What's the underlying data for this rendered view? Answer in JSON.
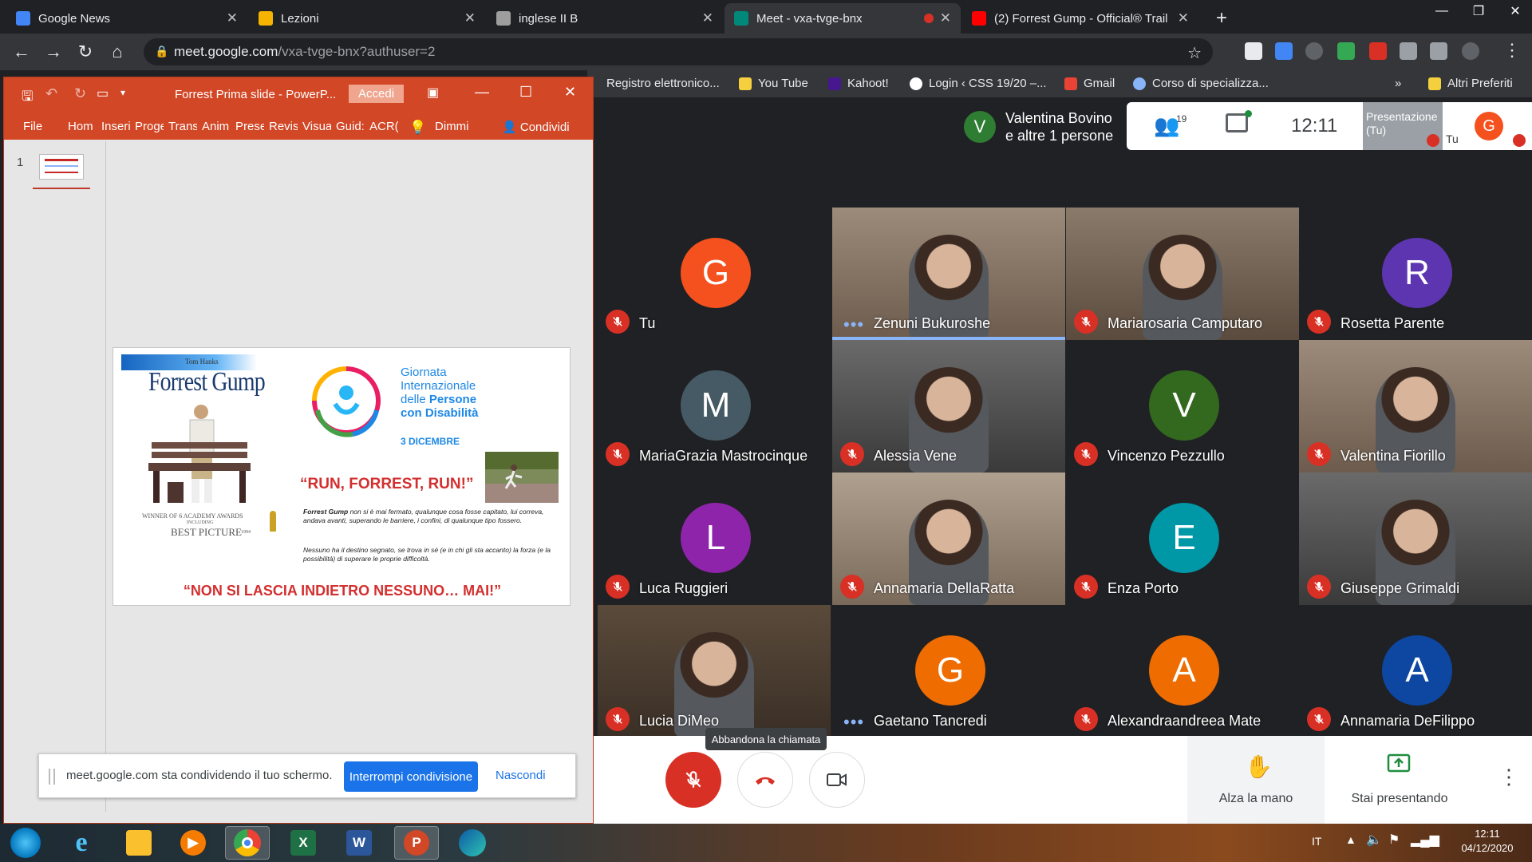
{
  "browser": {
    "tabs": [
      {
        "label": "Google News",
        "icon": "google-news-icon",
        "color": "#4285f4"
      },
      {
        "label": "Lezioni",
        "icon": "classroom-icon",
        "color": "#f4b400"
      },
      {
        "label": "inglese II B",
        "icon": "doc-icon",
        "color": "#9e9e9e"
      },
      {
        "label": "Meet - vxa-tvge-bnx",
        "icon": "meet-icon",
        "color": "#00897b"
      },
      {
        "label": "(2) Forrest Gump - Official® Trail",
        "icon": "youtube-icon",
        "color": "#ff0000"
      }
    ],
    "url_host": "meet.google.com",
    "url_path": "/vxa-tvge-bnx?authuser=2",
    "bookmarks": [
      "Registro elettronico...",
      "You Tube",
      "Kahoot!",
      "Login ‹ CSS 19/20 –...",
      "Gmail",
      "Corso di specializza...",
      "Altri Preferiti"
    ]
  },
  "powerpoint": {
    "title": "Forrest Prima slide  -  PowerP...",
    "signin": "Accedi",
    "ribbon": [
      "File",
      "Hom",
      "Inseri",
      "Proge",
      "Trans",
      "Anim",
      "Prese",
      "Revis",
      "Visua",
      "Guid:",
      "ACR(",
      "Dimmi",
      "Condividi"
    ],
    "slide_number": "1",
    "slide": {
      "tom_hanks": "Tom Hanks",
      "movie_title": "Forrest Gump",
      "awards1": "WINNER OF 6 ACADEMY AWARDS",
      "awards2": "INCLUDING",
      "awards3": "BEST PICTURE",
      "awards4": "1994",
      "event_l1": "Giornata",
      "event_l2": "Internazionale",
      "event_l3a": "delle ",
      "event_l3b": "Persone",
      "event_l4": "con Disabilità",
      "event_date": "3 DICEMBRE",
      "run": "“RUN, FORREST, RUN!”",
      "text_name": "Forrest Gump",
      "text1": " non si è mai fermato, qualunque cosa fosse capitato, lui correva, andava avanti, superando le barriere, i confini, di qualunque tipo fossero.",
      "text2": "Nessuno ha il destino segnato, se trova in sé (e in chi gli sta accanto) la forza (e la possibilità) di superare le proprie difficoltà.",
      "footer": "“NON SI LASCIA INDIETRO NESSUNO… MAI!”"
    }
  },
  "sharebar": {
    "message": "meet.google.com sta condividendo il tuo schermo.",
    "stop": "Interrompi condivisione",
    "hide": "Nascondi"
  },
  "meet": {
    "presenter": {
      "initial": "V",
      "line1": "Valentina Bovino",
      "line2": "e altre 1 persone"
    },
    "people_count": "19",
    "time": "12:11",
    "presentation_label1": "Presentazione",
    "presentation_label2": "(Tu)",
    "self_label": "Tu",
    "self_initial": "G",
    "tooltip": "Abbandona la chiamata",
    "raise_hand": "Alza la mano",
    "presenting": "Stai presentando",
    "participants": [
      {
        "name": "Tu",
        "initial": "G",
        "color": "#f4511e",
        "video": false,
        "state": "muted"
      },
      {
        "name": "Zenuni Bukuroshe",
        "initial": "",
        "color": "",
        "video": true,
        "state": "speaking"
      },
      {
        "name": "Mariarosaria Camputaro",
        "initial": "",
        "color": "",
        "video": true,
        "state": "muted"
      },
      {
        "name": "Rosetta Parente",
        "initial": "R",
        "color": "#5e35b1",
        "video": false,
        "state": "muted"
      },
      {
        "name": "MariaGrazia Mastrocinque",
        "initial": "M",
        "color": "#455a64",
        "video": false,
        "state": "muted"
      },
      {
        "name": "Alessia Vene",
        "initial": "",
        "color": "",
        "video": true,
        "state": "muted"
      },
      {
        "name": "Vincenzo Pezzullo",
        "initial": "V",
        "color": "#33691e",
        "video": false,
        "state": "muted"
      },
      {
        "name": "Valentina Fiorillo",
        "initial": "",
        "color": "",
        "video": true,
        "state": "muted"
      },
      {
        "name": "Luca Ruggieri",
        "initial": "L",
        "color": "#8e24aa",
        "video": false,
        "state": "muted"
      },
      {
        "name": "Annamaria DellaRatta",
        "initial": "",
        "color": "",
        "video": true,
        "state": "muted"
      },
      {
        "name": "Enza Porto",
        "initial": "E",
        "color": "#0097a7",
        "video": false,
        "state": "muted"
      },
      {
        "name": "Giuseppe Grimaldi",
        "initial": "",
        "color": "",
        "video": true,
        "state": "muted"
      },
      {
        "name": "Lucia DiMeo",
        "initial": "",
        "color": "",
        "video": true,
        "state": "muted"
      },
      {
        "name": "Gaetano Tancredi",
        "initial": "G",
        "color": "#ef6c00",
        "video": false,
        "state": "speaking"
      },
      {
        "name": "Alexandraandreea Mate",
        "initial": "A",
        "color": "#ef6c00",
        "video": false,
        "state": "muted"
      },
      {
        "name": "Annamaria DeFilippo",
        "initial": "A",
        "color": "#0d47a1",
        "video": false,
        "state": "muted"
      }
    ]
  },
  "taskbar": {
    "apps": [
      "start-button",
      "internet-explorer",
      "file-explorer",
      "media-player",
      "chrome",
      "excel",
      "word",
      "powerpoint",
      "edge"
    ],
    "lang": "IT",
    "clock_time": "12:11",
    "clock_date": "04/12/2020"
  }
}
